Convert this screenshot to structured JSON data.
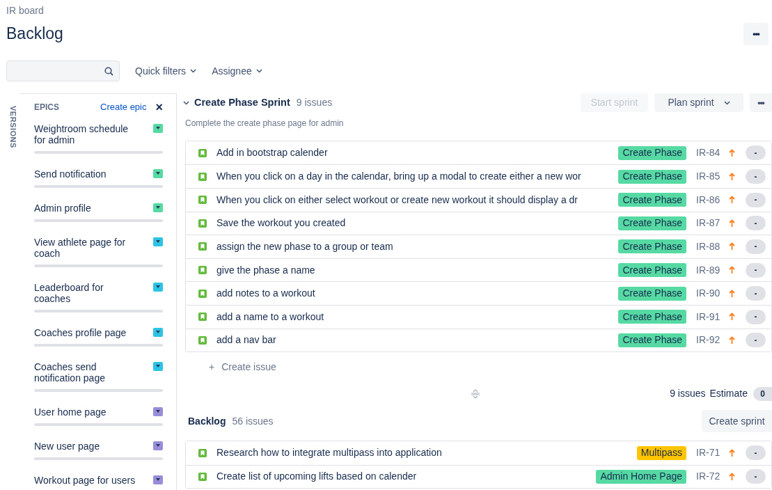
{
  "breadcrumb": "IR board",
  "title": "Backlog",
  "more_button": "•••",
  "filters": {
    "quick_filters": "Quick filters",
    "assignee": "Assignee"
  },
  "sidebar": {
    "versions_tab": "VERSIONS",
    "epics_heading": "EPICS",
    "create_epic": "Create epic",
    "close": "×",
    "epics": [
      {
        "name": "Weightroom schedule for admin",
        "color": "#57d9a3"
      },
      {
        "name": "Send notification",
        "color": "#57d9a3"
      },
      {
        "name": "Admin profile",
        "color": "#57d9a3"
      },
      {
        "name": "View athlete page for coach",
        "color": "#2bc4e2"
      },
      {
        "name": "Leaderboard for coaches",
        "color": "#2bc4e2"
      },
      {
        "name": "Coaches profile page",
        "color": "#2bc4e2"
      },
      {
        "name": "Coaches send notification page",
        "color": "#2bc4e2"
      },
      {
        "name": "User home page",
        "color": "#998dd9"
      },
      {
        "name": "New user page",
        "color": "#998dd9"
      },
      {
        "name": "Workout page for users",
        "color": "#998dd9"
      }
    ]
  },
  "sprint": {
    "name": "Create Phase Sprint",
    "count": "9 issues",
    "goal": "Complete the create phase page for admin",
    "start_button": {
      "label": "Start sprint",
      "disabled": true
    },
    "plan_button": "Plan sprint",
    "more_button": "•••",
    "issues": [
      {
        "summary": "Add in bootstrap calender",
        "epic": "Create Phase",
        "color": "#57d9a3",
        "key": "IR-84",
        "estimate": "-"
      },
      {
        "summary": "When you click on a day in the calendar, bring up a modal to create either a new wor",
        "epic": "Create Phase",
        "color": "#57d9a3",
        "key": "IR-85",
        "estimate": "-"
      },
      {
        "summary": "When you click on either select workout or create new workout it should display a dr",
        "epic": "Create Phase",
        "color": "#57d9a3",
        "key": "IR-86",
        "estimate": "-"
      },
      {
        "summary": "Save the workout you created",
        "epic": "Create Phase",
        "color": "#57d9a3",
        "key": "IR-87",
        "estimate": "-"
      },
      {
        "summary": "assign the new phase to a group or team",
        "epic": "Create Phase",
        "color": "#57d9a3",
        "key": "IR-88",
        "estimate": "-"
      },
      {
        "summary": "give the phase a name",
        "epic": "Create Phase",
        "color": "#57d9a3",
        "key": "IR-89",
        "estimate": "-"
      },
      {
        "summary": "add notes to a workout",
        "epic": "Create Phase",
        "color": "#57d9a3",
        "key": "IR-90",
        "estimate": "-"
      },
      {
        "summary": "add a name to a workout",
        "epic": "Create Phase",
        "color": "#57d9a3",
        "key": "IR-91",
        "estimate": "-"
      },
      {
        "summary": "add a nav bar",
        "epic": "Create Phase",
        "color": "#57d9a3",
        "key": "IR-92",
        "estimate": "-"
      }
    ],
    "create_issue": "Create issue",
    "create_issue_plus": "+",
    "footer_count": "9 issues",
    "footer_estimate_label": "Estimate",
    "footer_estimate": "0"
  },
  "backlog": {
    "name": "Backlog",
    "count": "56 issues",
    "create_sprint": "Create sprint",
    "issues": [
      {
        "summary": "Research how to integrate multipass into application",
        "epic": "Multipass",
        "color": "#ffc400",
        "key": "IR-71",
        "estimate": "-"
      },
      {
        "summary": "Create list of upcoming lifts based on calender",
        "epic": "Admin Home Page",
        "color": "#57d9a3",
        "key": "IR-72",
        "estimate": "-"
      }
    ]
  }
}
